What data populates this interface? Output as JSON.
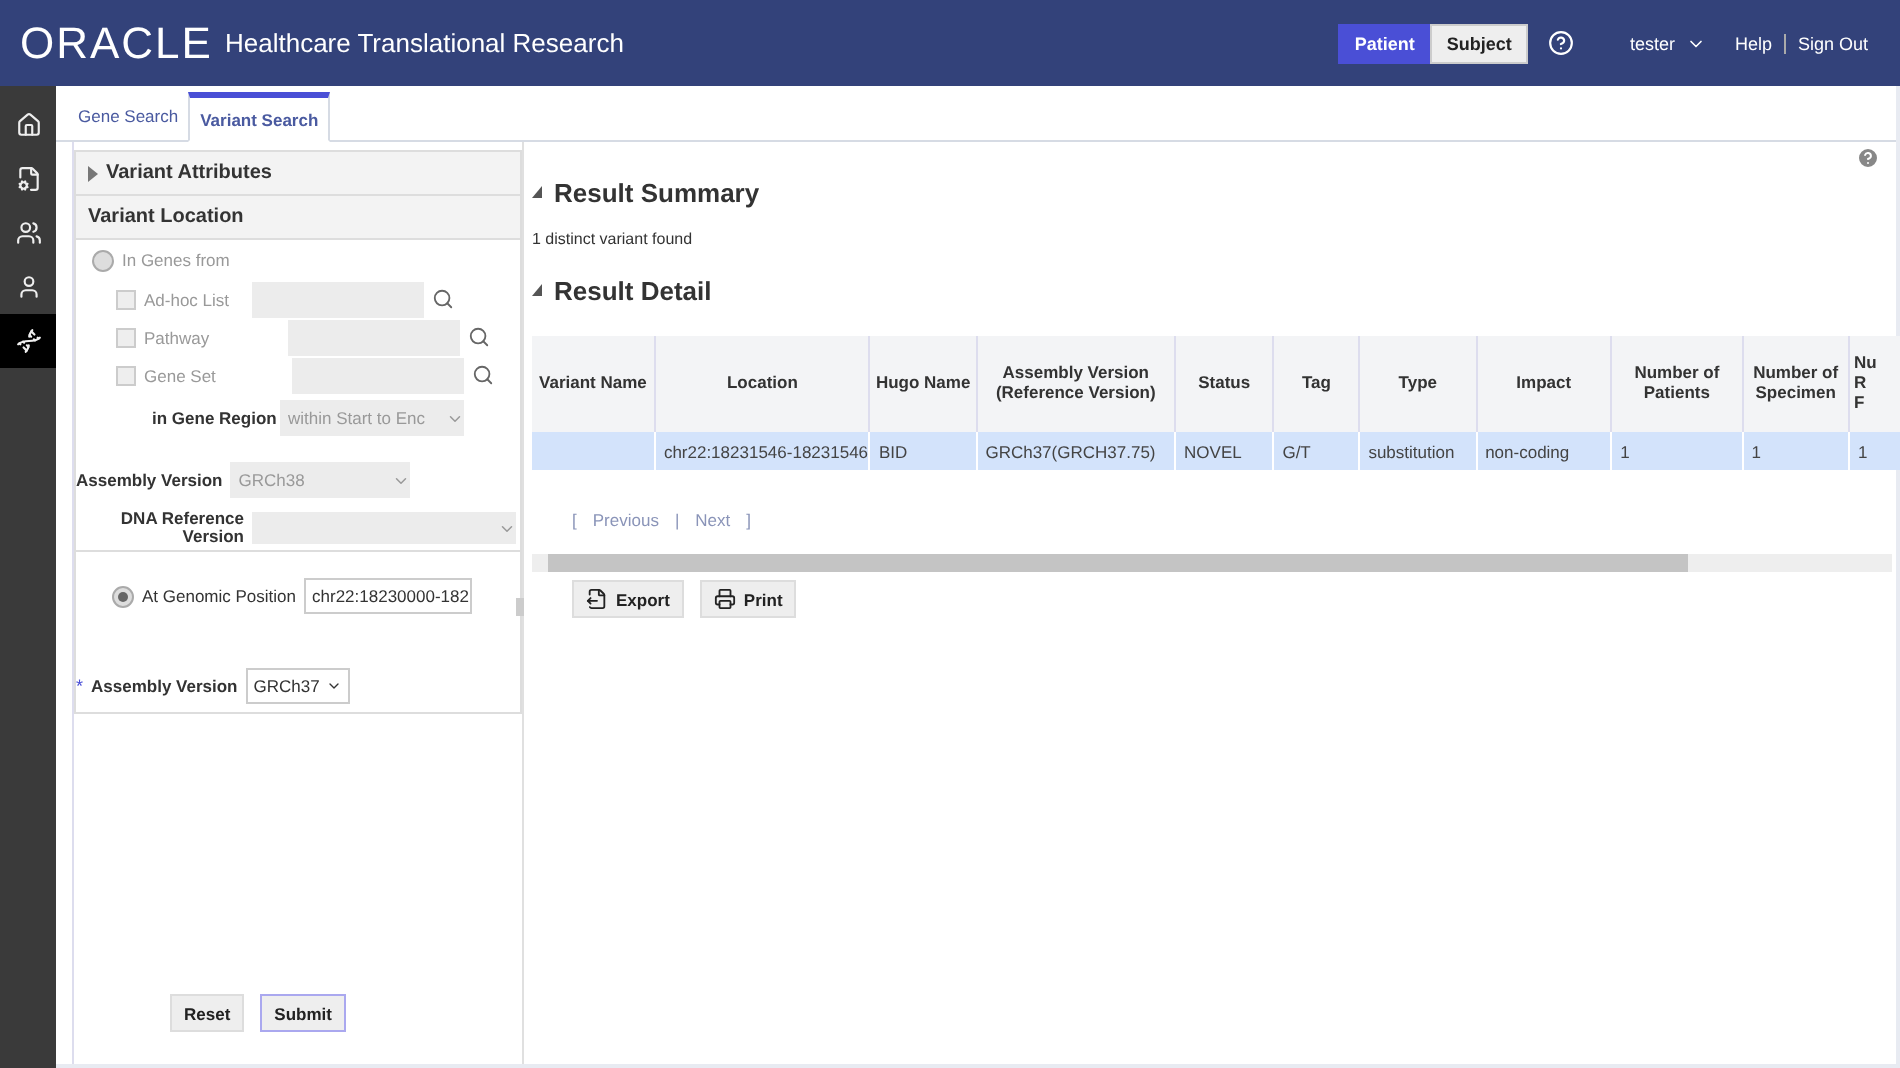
{
  "header": {
    "logo": "ORACLE",
    "title": "Healthcare Translational Research",
    "mode_toggle": [
      {
        "label": "Patient",
        "selected": true
      },
      {
        "label": "Subject",
        "selected": false
      }
    ],
    "user": "tester",
    "links": [
      "Help",
      "Sign Out"
    ]
  },
  "sidebar": {
    "items": [
      {
        "kind": "home",
        "selected": false
      },
      {
        "kind": "document",
        "selected": false
      },
      {
        "kind": "group",
        "selected": false
      },
      {
        "kind": "person",
        "selected": false
      },
      {
        "kind": "dna",
        "selected": true
      }
    ]
  },
  "tabs": [
    {
      "label": "Gene Search",
      "selected": false
    },
    {
      "label": "Variant Search",
      "selected": true
    }
  ],
  "filter_panel": {
    "sections": [
      {
        "label": "Variant Attributes",
        "expanded": false
      },
      {
        "label": "Variant Location",
        "expanded": true
      }
    ],
    "genes_option": {
      "label": "In Genes from",
      "selected": false
    },
    "gene_sources": [
      {
        "label": "Ad-hoc List",
        "checked": false
      },
      {
        "label": "Pathway",
        "checked": false
      },
      {
        "label": "Gene Set",
        "checked": false
      }
    ],
    "gene_region": {
      "label": "in Gene Region",
      "value": "within Start to Enc"
    },
    "assembly_disabled": {
      "label": "Assembly Version",
      "value": "GRCh38"
    },
    "dna_reference": {
      "label": "DNA Reference Version"
    },
    "position_option": {
      "label": "At Genomic Position",
      "selected": true,
      "value": "chr22:18230000-182"
    },
    "assembly": {
      "required_mark": "*",
      "label": "Assembly Version",
      "value": "GRCh37"
    },
    "buttons": [
      "Reset",
      "Submit"
    ]
  },
  "results": {
    "summary": {
      "title": "Result Summary",
      "expanded": true,
      "text": "1 distinct variant found"
    },
    "detail": {
      "title": "Result Detail",
      "expanded": true
    },
    "table": {
      "columns": [
        "Variant Name",
        "Location",
        "Hugo Name",
        "Assembly Version (Reference Version)",
        "Status",
        "Tag",
        "Type",
        "Impact",
        "Number of Patients",
        "Number of Specimen",
        "Nu\nR\nF"
      ],
      "rows": [
        {
          "selected": true,
          "cells": [
            "",
            "chr22:18231546-18231546",
            "BID",
            "GRCh37(GRCH37.75)",
            "NOVEL",
            "G/T",
            "substitution",
            "non-coding",
            "1",
            "1",
            "1"
          ]
        }
      ]
    },
    "pager": [
      "[",
      "Previous",
      "|",
      "Next",
      "]"
    ],
    "buttons": [
      {
        "kind": "export",
        "label": "Export"
      },
      {
        "kind": "print",
        "label": "Print"
      }
    ]
  }
}
